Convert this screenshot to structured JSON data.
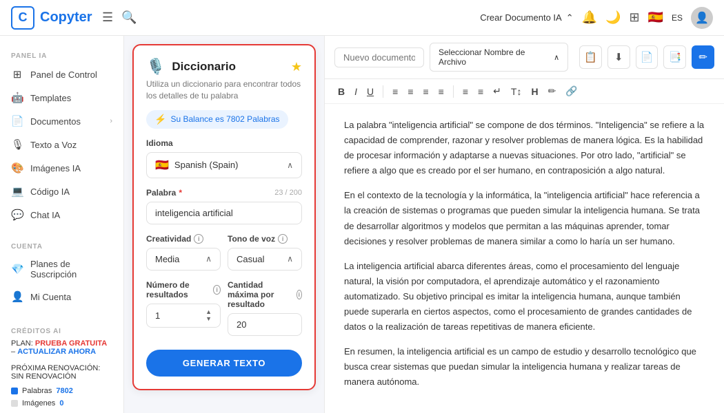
{
  "app": {
    "name": "Copyter",
    "logo_letter": "C"
  },
  "navbar": {
    "crear_documento": "Crear Documento IA",
    "crear_caret": "^",
    "lang": "ES"
  },
  "sidebar": {
    "panel_ia_label": "PANEL IA",
    "items": [
      {
        "id": "panel-control",
        "label": "Panel de Control",
        "icon": "⊞",
        "arrow": false
      },
      {
        "id": "templates",
        "label": "Templates",
        "icon": "🤖",
        "arrow": false,
        "active": false
      },
      {
        "id": "documentos",
        "label": "Documentos",
        "icon": "📄",
        "arrow": true
      },
      {
        "id": "texto-voz",
        "label": "Texto a Voz",
        "icon": "🎙",
        "arrow": false
      },
      {
        "id": "imagenes-ia",
        "label": "Imágenes IA",
        "icon": "🎨",
        "arrow": false
      },
      {
        "id": "codigo-ia",
        "label": "Código IA",
        "icon": "💻",
        "arrow": false
      },
      {
        "id": "chat-ia",
        "label": "Chat IA",
        "icon": "💬",
        "arrow": false
      }
    ],
    "cuenta_label": "CUENTA",
    "cuenta_items": [
      {
        "id": "planes",
        "label": "Planes de Suscripción",
        "icon": "💎"
      },
      {
        "id": "mi-cuenta",
        "label": "Mi Cuenta",
        "icon": "👤"
      }
    ],
    "creditos_label": "CRÉDITOS AI",
    "plan_label": "PLAN:",
    "prueba": "PRUEBA GRATUITA",
    "separador": " – ",
    "actualizar": "ACTUALIZAR AHORA",
    "proxima": "PRÓXIMA RENOVACIÓN: SIN RENOVACIÓN",
    "palabras_label": "Palabras",
    "palabras_val": "7802",
    "imagenes_label": "Imágenes",
    "imagenes_val": "0"
  },
  "card": {
    "emoji": "🎙️",
    "title": "Diccionario",
    "desc": "Utiliza un diccionario para encontrar todos los detalles de tu palabra",
    "balance_text": "Su Balance es 7802 Palabras",
    "idioma_label": "Idioma",
    "idioma_flag": "🇪🇸",
    "idioma_value": "Spanish (Spain)",
    "palabra_label": "Palabra",
    "palabra_char_count": "23 / 200",
    "palabra_value": "inteligencia artificial",
    "creatividad_label": "Creatividad",
    "creatividad_info": "i",
    "creatividad_value": "Media",
    "tono_label": "Tono de voz",
    "tono_info": "i",
    "tono_value": "Casual",
    "num_resultados_label": "Número de resultados",
    "num_resultados_info": "i",
    "num_resultados_value": "1",
    "cantidad_max_label": "Cantidad máxima por resultado",
    "cantidad_max_info": "i",
    "cantidad_max_value": "20",
    "generar_btn": "GENERAR TEXTO"
  },
  "editor": {
    "doc_name_placeholder": "Nuevo documento",
    "select_nombre_label": "Seleccionar Nombre de Archivo",
    "content_paragraphs": [
      "La palabra \"inteligencia artificial\" se compone de dos términos. \"Inteligencia\" se refiere a la capacidad de comprender, razonar y resolver problemas de manera lógica. Es la habilidad de procesar información y adaptarse a nuevas situaciones. Por otro lado, \"artificial\" se refiere a algo que es creado por el ser humano, en contraposición a algo natural.",
      "En el contexto de la tecnología y la informática, la \"inteligencia artificial\" hace referencia a la creación de sistemas o programas que pueden simular la inteligencia humana. Se trata de desarrollar algoritmos y modelos que permitan a las máquinas aprender, tomar decisiones y resolver problemas de manera similar a como lo haría un ser humano.",
      "La inteligencia artificial abarca diferentes áreas, como el procesamiento del lenguaje natural, la visión por computadora, el aprendizaje automático y el razonamiento automatizado. Su objetivo principal es imitar la inteligencia humana, aunque también puede superarla en ciertos aspectos, como el procesamiento de grandes cantidades de datos o la realización de tareas repetitivas de manera eficiente.",
      "En resumen, la inteligencia artificial es un campo de estudio y desarrollo tecnológico que busca crear sistemas que puedan simular la inteligencia humana y realizar tareas de manera autónoma."
    ]
  }
}
